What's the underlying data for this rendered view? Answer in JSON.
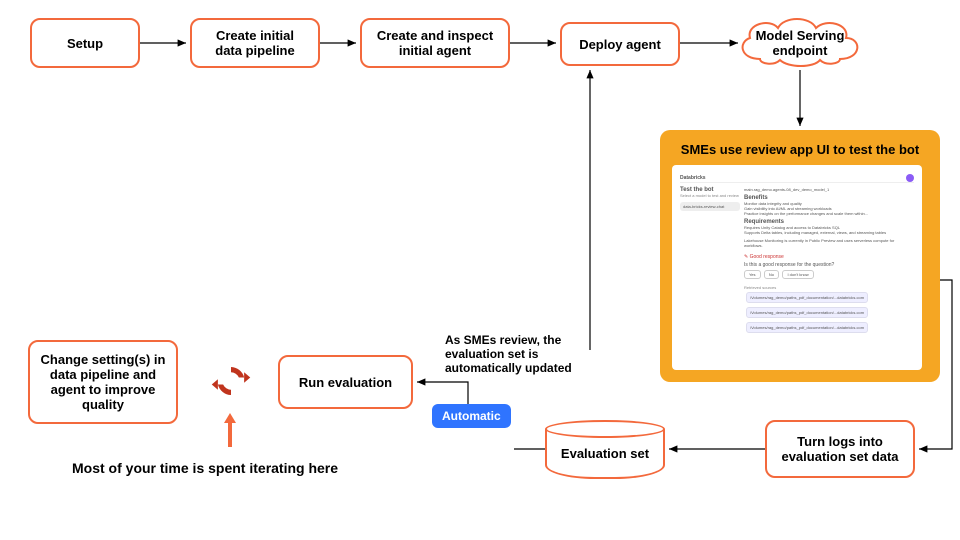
{
  "nodes": {
    "setup": "Setup",
    "create_pipeline": "Create initial data pipeline",
    "create_agent": "Create and inspect initial agent",
    "deploy": "Deploy agent",
    "serving": "Model Serving endpoint",
    "turn_logs": "Turn logs into evaluation set data",
    "eval_set": "Evaluation set",
    "run_eval": "Run evaluation",
    "change_settings": "Change setting(s) in data pipeline and agent to improve quality"
  },
  "panel": {
    "title": "SMEs use review app UI to test the bot",
    "mock": {
      "header_left": "Databricks",
      "side_title": "Test the bot",
      "side_sub": "Select a model to test and review",
      "side_button": "data-bricks-review-chat",
      "main_path": "main.rag_demo.agents-08_dev_demo_model_1",
      "section1": "Benefits",
      "b1": "Monitor data integrity and quality",
      "b2": "Gain visibility into AI/ML and streaming workloads",
      "b3": "Practice insights on the performance changes and scale them within...",
      "section2": "Requirements",
      "r1": "Requires Unity Catalog and access to Databricks SQL",
      "r2": "Supports Delta tables, including managed, external, views, and streaming tables",
      "footnote": "Lakehouse Monitoring is currently in Public Preview and uses serverless compute for workflows.",
      "good": "Good response",
      "prompt": "Is this a good response for the question?",
      "yes": "Yes",
      "no": "No",
      "idk": "I don't know",
      "sources_label": "Retrieved sources",
      "chip": "/Volumes/rag_demo/paths_pdf_documentation/...databricks.com"
    }
  },
  "tag": "Automatic",
  "note": "As SMEs review, the evaluation set is automatically updated",
  "caption": "Most of your time is spent iterating here",
  "chart_data": {
    "type": "flowchart",
    "nodes": [
      {
        "id": "setup",
        "label": "Setup",
        "shape": "rect"
      },
      {
        "id": "create_pipeline",
        "label": "Create initial data pipeline",
        "shape": "rect"
      },
      {
        "id": "create_agent",
        "label": "Create and inspect initial agent",
        "shape": "rect"
      },
      {
        "id": "deploy",
        "label": "Deploy agent",
        "shape": "rect"
      },
      {
        "id": "serving",
        "label": "Model Serving endpoint",
        "shape": "cloud"
      },
      {
        "id": "review_app",
        "label": "SMEs use review app UI to test the bot",
        "shape": "panel"
      },
      {
        "id": "turn_logs",
        "label": "Turn logs into evaluation set data",
        "shape": "rect"
      },
      {
        "id": "eval_set",
        "label": "Evaluation set",
        "shape": "cylinder"
      },
      {
        "id": "run_eval",
        "label": "Run evaluation",
        "shape": "rect"
      },
      {
        "id": "change_settings",
        "label": "Change setting(s) in data pipeline and agent to improve quality",
        "shape": "rect"
      }
    ],
    "edges": [
      {
        "from": "setup",
        "to": "create_pipeline"
      },
      {
        "from": "create_pipeline",
        "to": "create_agent"
      },
      {
        "from": "create_agent",
        "to": "deploy"
      },
      {
        "from": "deploy",
        "to": "serving"
      },
      {
        "from": "serving",
        "to": "review_app"
      },
      {
        "from": "review_app",
        "to": "turn_logs"
      },
      {
        "from": "turn_logs",
        "to": "eval_set"
      },
      {
        "from": "eval_set",
        "to": "run_eval",
        "label": "Automatic"
      },
      {
        "from": "run_eval",
        "to": "change_settings",
        "bidirectional_cycle": true
      },
      {
        "from": "change_settings",
        "to": "deploy",
        "implied_via_cycle": true
      }
    ],
    "annotations": [
      {
        "text": "As SMEs review, the evaluation set is automatically updated",
        "near": "run_eval"
      },
      {
        "text": "Most of your time is spent iterating here",
        "near": "change_settings/run_eval cycle"
      }
    ]
  }
}
